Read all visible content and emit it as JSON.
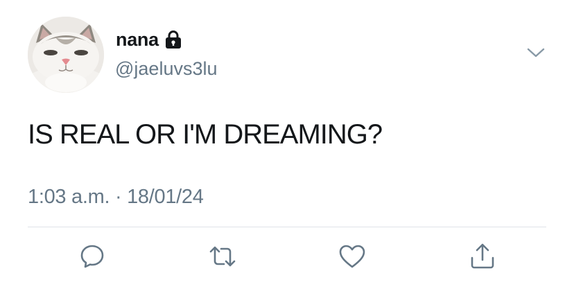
{
  "tweet": {
    "display_name": "nana",
    "handle": "@jaeluvs3lu",
    "text": "IS REAL OR I'M DREAMING?",
    "time": "1:03 a.m.",
    "separator": "·",
    "date": "18/01/24"
  },
  "icons": {
    "account": "lock-icon",
    "menu": "chevron-down-icon",
    "actions": [
      "reply-icon",
      "retweet-icon",
      "like-icon",
      "share-icon"
    ]
  },
  "colors": {
    "text": "#14171a",
    "secondary_text": "#657786",
    "icon": "#657786",
    "divider": "#dfe3e8",
    "background": "#ffffff"
  }
}
